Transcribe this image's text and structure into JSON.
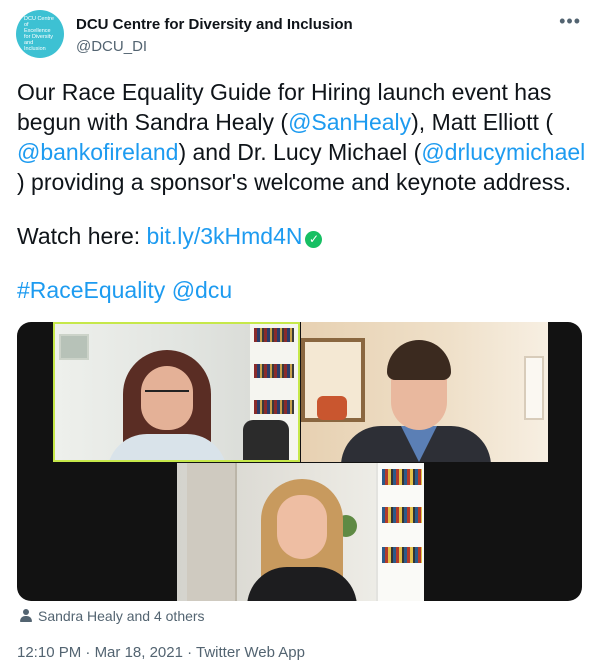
{
  "account": {
    "name": "DCU Centre for Diversity and Inclusion",
    "handle": "@DCU_DI",
    "avatar_text": "DCU Centre of Excellence for Diversity and Inclusion"
  },
  "more_label": "•••",
  "tweet": {
    "line1": "Our Race Equality Guide for Hiring launch event has",
    "line2_pre": "begun with Sandra Healy (",
    "line2_link": "@SanHealy",
    "line2_post": "), Matt Elliott (",
    "line3_link1": "@bankofireland",
    "line3_mid": ") and Dr. Lucy Michael (",
    "line3_link2": "@drlucymichael",
    "line4": ") providing a sponsor's welcome and keynote address.",
    "watch_label": "Watch here: ",
    "watch_link": "bit.ly/3kHmd4N",
    "check_icon": "✓",
    "hashtag": "#RaceEquality",
    "mention": "@dcu"
  },
  "tagged": {
    "icon": "person-icon",
    "text": "Sandra Healy and 4 others"
  },
  "meta": {
    "time": "12:10 PM",
    "sep1": " · ",
    "date": "Mar 18, 2021",
    "sep2": " · ",
    "source": "Twitter Web App"
  },
  "colors": {
    "link": "#1d9bf0",
    "secondary_text": "#536471",
    "avatar_bg": "#3dc1d3",
    "active_speaker_border": "#c6e84a",
    "verified_check": "#17bf63"
  }
}
